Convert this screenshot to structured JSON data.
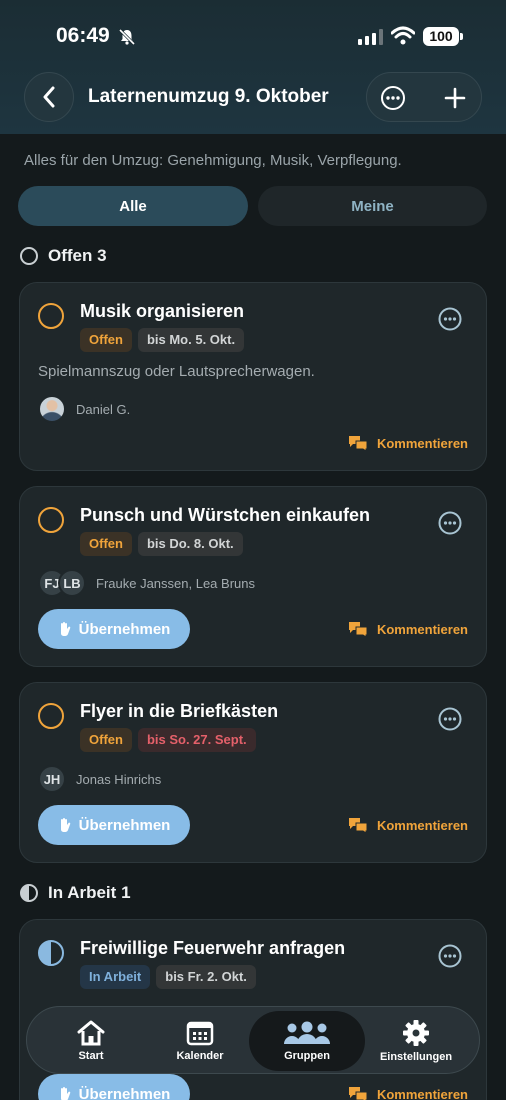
{
  "status_bar": {
    "time": "06:49",
    "battery": "100"
  },
  "header": {
    "title": "Laternenumzug 9. Oktober"
  },
  "description": "Alles für den Umzug: Genehmigung, Musik, Verpflegung.",
  "filters": {
    "all": "Alle",
    "mine": "Meine"
  },
  "sections": [
    {
      "label": "Offen",
      "count": "3"
    },
    {
      "label": "In Arbeit",
      "count": "1"
    }
  ],
  "tasks": [
    {
      "title": "Musik organisieren",
      "status": "Offen",
      "due": "bis Mo. 5. Okt.",
      "note": "Spielmannszug oder Lautsprecherwagen.",
      "avatars": [],
      "people": "Daniel G.",
      "comment": "Kommentieren"
    },
    {
      "title": "Punsch und Würstchen einkaufen",
      "status": "Offen",
      "due": "bis Do. 8. Okt.",
      "avatars": [
        "FJ",
        "LB"
      ],
      "people": "Frauke Janssen, Lea Bruns",
      "take": "Übernehmen",
      "comment": "Kommentieren"
    },
    {
      "title": "Flyer in die Briefkästen",
      "status": "Offen",
      "due": "bis So. 27. Sept.",
      "avatars": [
        "JH"
      ],
      "people": "Jonas Hinrichs",
      "take": "Übernehmen",
      "comment": "Kommentieren"
    },
    {
      "title": "Freiwillige Feuerwehr anfragen",
      "status": "In Arbeit",
      "due": "bis Fr. 2. Okt.",
      "take": "Übernehmen",
      "comment": "Kommentieren"
    }
  ],
  "tabs": [
    {
      "label": "Start",
      "icon": "home-icon"
    },
    {
      "label": "Kalender",
      "icon": "calendar-icon"
    },
    {
      "label": "Gruppen",
      "icon": "people-icon",
      "active": true
    },
    {
      "label": "Einstellungen",
      "icon": "gear-icon"
    }
  ],
  "colors": {
    "accent_orange": "#f0a43b",
    "accent_blue": "#88bce7",
    "late_red": "#e4606a",
    "background": "#141a1c"
  }
}
